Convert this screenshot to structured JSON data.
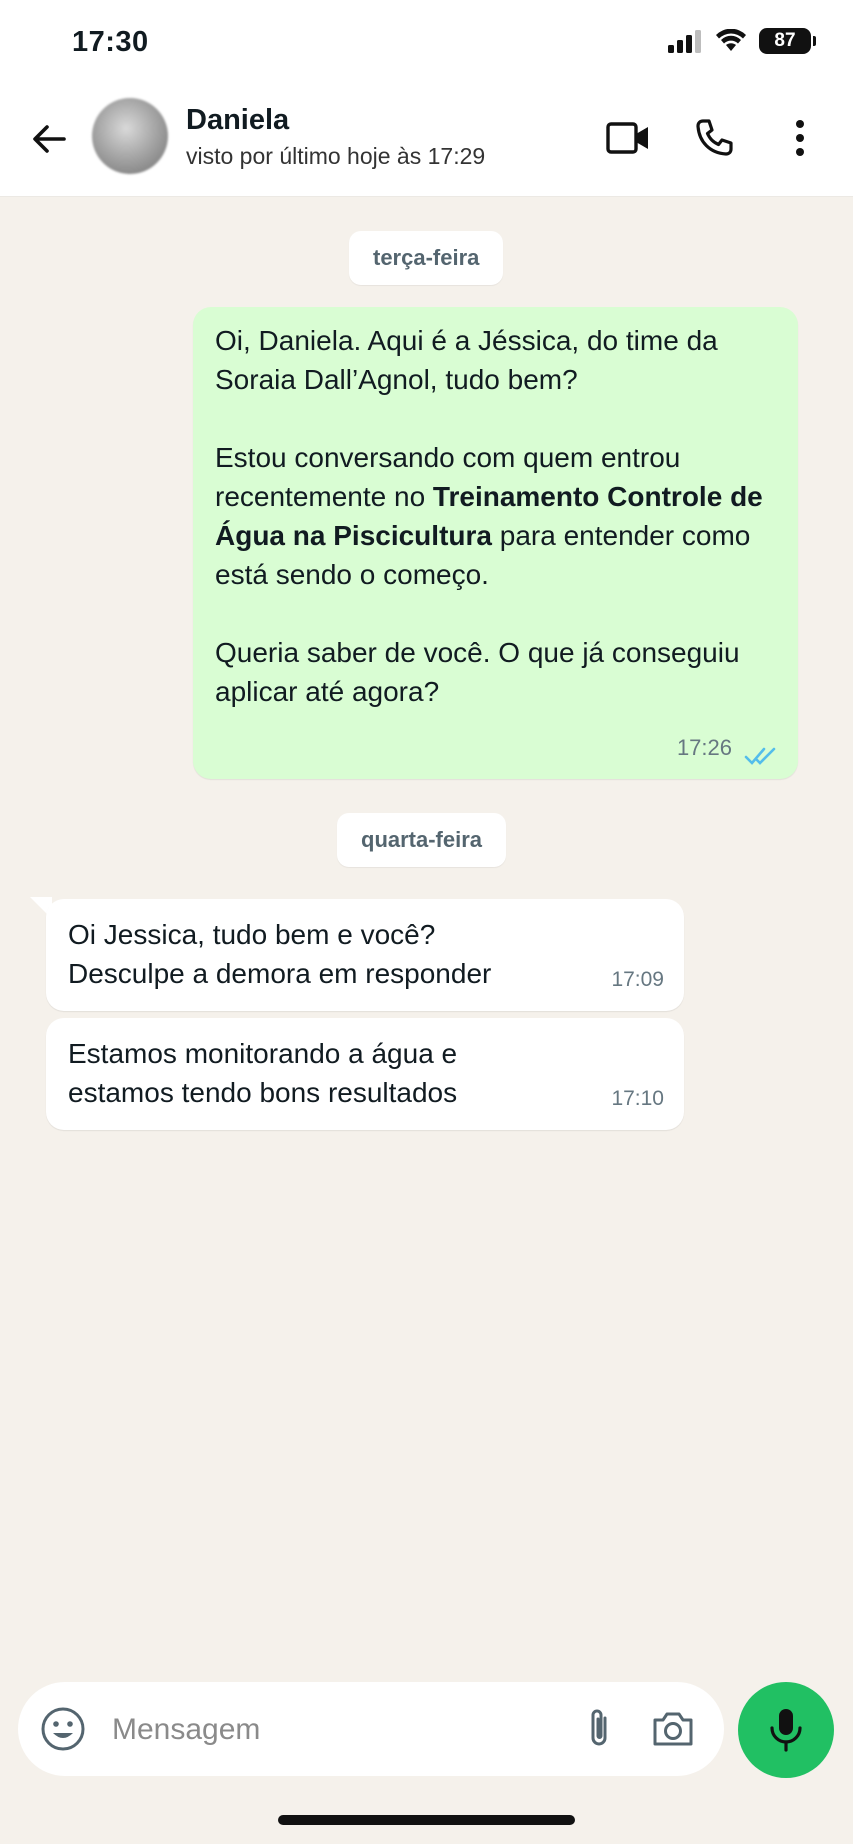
{
  "status_bar": {
    "time": "17:30",
    "battery": "87"
  },
  "header": {
    "contact_name": "Daniela",
    "contact_status": "visto por último hoje às 17:29"
  },
  "chat": {
    "day_1": "terça-feira",
    "day_2": "quarta-feira",
    "outgoing": {
      "p1": "Oi, Daniela. Aqui é a Jéssica, do time da Soraia Dall’Agnol, tudo bem?",
      "p2_before": "Estou conversando com quem entrou recentemente no ",
      "p2_bold": "Treinamento Controle de Água na Piscicultura",
      "p2_after": " para entender como está sendo o começo.",
      "p3": "Queria saber de você. O que já conseguiu aplicar até agora?",
      "time": "17:26",
      "tick_color": "#53bdeb"
    },
    "incoming": [
      {
        "text": "Oi Jessica, tudo bem e você? Desculpe a demora em responder",
        "time": "17:09"
      },
      {
        "text": "Estamos monitorando a água e estamos tendo bons resultados",
        "time": "17:10"
      }
    ]
  },
  "composer": {
    "placeholder": "Mensagem"
  },
  "colors": {
    "accent": "#21c063",
    "outgoing_bubble": "#d9fdd3",
    "background": "#f5f1eb"
  }
}
